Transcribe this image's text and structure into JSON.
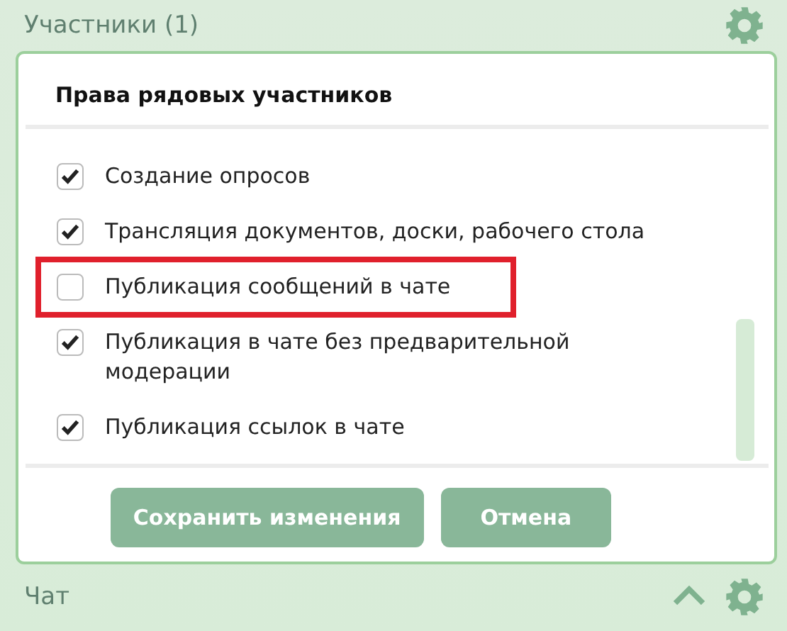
{
  "header": {
    "title": "Участники (1)"
  },
  "panel": {
    "heading": "Права рядовых участников",
    "items": [
      {
        "label": "Создание опросов",
        "checked": true,
        "highlighted": false
      },
      {
        "label": "Трансляция документов, доски, рабочего стола",
        "checked": true,
        "highlighted": false
      },
      {
        "label": "Публикация сообщений в чате",
        "checked": false,
        "highlighted": true
      },
      {
        "label": "Публикация в чате без предварительной модерации",
        "checked": true,
        "highlighted": false
      },
      {
        "label": "Публикация ссылок в чате",
        "checked": true,
        "highlighted": false
      }
    ],
    "buttons": [
      {
        "label": "Сохранить изменения"
      },
      {
        "label": "Отмена"
      }
    ]
  },
  "footer": {
    "title": "Чат",
    "expanded": true
  }
}
